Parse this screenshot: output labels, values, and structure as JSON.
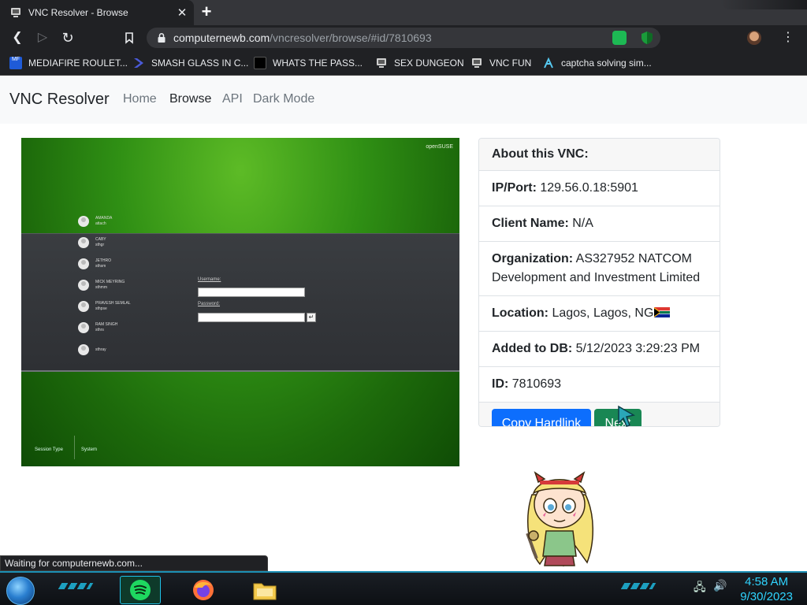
{
  "browser": {
    "tab_title": "VNC Resolver - Browse",
    "close_glyph": "✕",
    "new_tab_glyph": "+",
    "url_host": "computernewb.com",
    "url_path": "/vncresolver/browse/#id/7810693",
    "back_glyph": "❮",
    "forward_glyph": "▷",
    "reload_glyph": "↻",
    "bookmark_glyph": "🔖",
    "menu_glyph": "⋮",
    "bookmarks": [
      {
        "label": "MEDIAFIRE ROULET...",
        "icon": "mediafire-icon",
        "color": "#1f5bd8"
      },
      {
        "label": "SMASH GLASS IN C...",
        "icon": "chevron-logo-icon",
        "color": "#4a5ad9"
      },
      {
        "label": "WHATS THE PASS...",
        "icon": "terminal-icon",
        "color": "#111111"
      },
      {
        "label": "SEX DUNGEON",
        "icon": "computernewb-icon",
        "color": "#cccccc"
      },
      {
        "label": "VNC FUN",
        "icon": "computernewb-icon",
        "color": "#cccccc"
      },
      {
        "label": "captcha solving sim...",
        "icon": "lambda-icon",
        "color": "#56c9f0"
      }
    ]
  },
  "site": {
    "brand": "VNC Resolver",
    "nav": [
      {
        "label": "Home",
        "active": false
      },
      {
        "label": "Browse",
        "active": true
      },
      {
        "label": "API",
        "active": false
      },
      {
        "label": "Dark Mode",
        "active": false
      }
    ]
  },
  "vnc_screenshot": {
    "logo_text": "openSUSE",
    "users": [
      {
        "name": "AMANDA",
        "sub": "attach"
      },
      {
        "name": "CABY",
        "sub": "sthgr"
      },
      {
        "name": "JETHRO",
        "sub": "sthsm"
      },
      {
        "name": "MICK MEYRING",
        "sub": "sthmm"
      },
      {
        "name": "PRAVESH SEMLAL",
        "sub": "sthpse"
      },
      {
        "name": "RAM SINGH",
        "sub": "sthrs"
      },
      {
        "name": "sthray",
        "sub": ""
      }
    ],
    "username_label": "Username:",
    "password_label": "Password:",
    "username_value": "",
    "password_value": "",
    "go_glyph": "↵",
    "session_type_label": "Session Type",
    "system_label": "System"
  },
  "about": {
    "title": "About this VNC:",
    "ip_label": "IP/Port:",
    "ip_value": "129.56.0.18:5901",
    "client_label": "Client Name:",
    "client_value": "N/A",
    "org_label": "Organization:",
    "org_value": "AS327952 NATCOM Development and Investment Limited",
    "location_label": "Location:",
    "location_value": "Lagos, Lagos, NG",
    "added_label": "Added to DB:",
    "added_value": "5/12/2023 3:29:23 PM",
    "id_label": "ID:",
    "id_value": "7810693",
    "copy_button": "Copy Hardlink",
    "next_button": "Next"
  },
  "status_text": "Waiting for computernewb.com...",
  "taskbar": {
    "time": "4:58 AM",
    "date": "9/30/2023",
    "apps": [
      "spotify-icon",
      "firefox-icon",
      "file-explorer-icon"
    ]
  },
  "colors": {
    "primary": "#0d6efd",
    "success": "#198754",
    "vnc_green": "#2f8f14",
    "taskbar_accent": "#1fc1e8"
  }
}
